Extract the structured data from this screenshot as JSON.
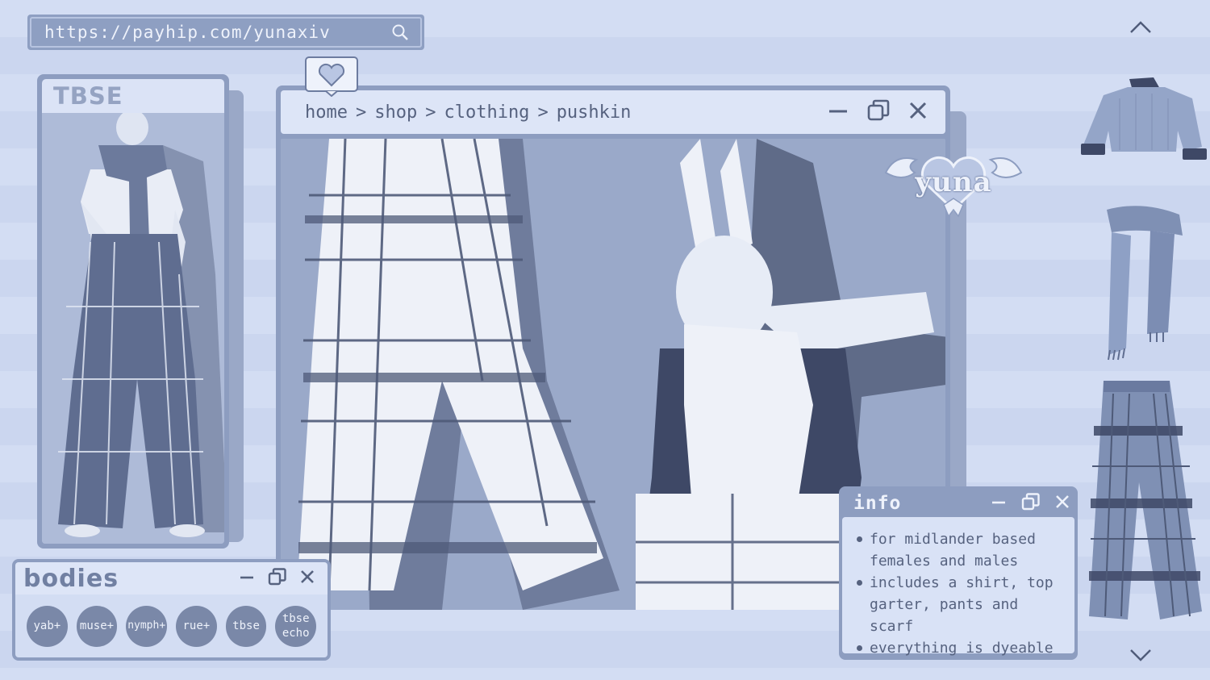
{
  "url_bar": {
    "url": "https://payhip.com/yunaxiv"
  },
  "left_card": {
    "title": "TBSE"
  },
  "main_window": {
    "breadcrumb": [
      {
        "label": "home"
      },
      {
        "label": "shop"
      },
      {
        "label": "clothing"
      },
      {
        "label": "pushkin"
      }
    ],
    "separator": ">"
  },
  "logo": {
    "text": "yuna"
  },
  "bodies_window": {
    "title": "bodies",
    "chips": [
      {
        "line1": "yab+",
        "line2": ""
      },
      {
        "line1": "muse+",
        "line2": ""
      },
      {
        "line1": "nymph+",
        "line2": ""
      },
      {
        "line1": "rue+",
        "line2": ""
      },
      {
        "line1": "tbse",
        "line2": ""
      },
      {
        "line1": "tbse",
        "line2": "echo"
      }
    ]
  },
  "info_window": {
    "title": "info",
    "bullets": [
      {
        "line1": "for midlander based",
        "line2": "females and males"
      },
      {
        "line1": "includes a shirt, top",
        "line2": "garter, pants and scarf"
      },
      {
        "line1": "everything is dyeable",
        "line2": ""
      }
    ]
  },
  "right_thumbs": {
    "items": [
      "shirt",
      "scarf",
      "pants"
    ]
  },
  "colors": {
    "background": "#d3ddf3",
    "frame": "#8d9dc0",
    "titlebar": "#dde5f7",
    "text": "#56627f",
    "chip": "#7a88a8"
  },
  "icons": [
    "search-icon",
    "chevron-up-icon",
    "chevron-down-icon",
    "heart-icon",
    "minimize-icon",
    "maximize-icon",
    "close-icon"
  ]
}
